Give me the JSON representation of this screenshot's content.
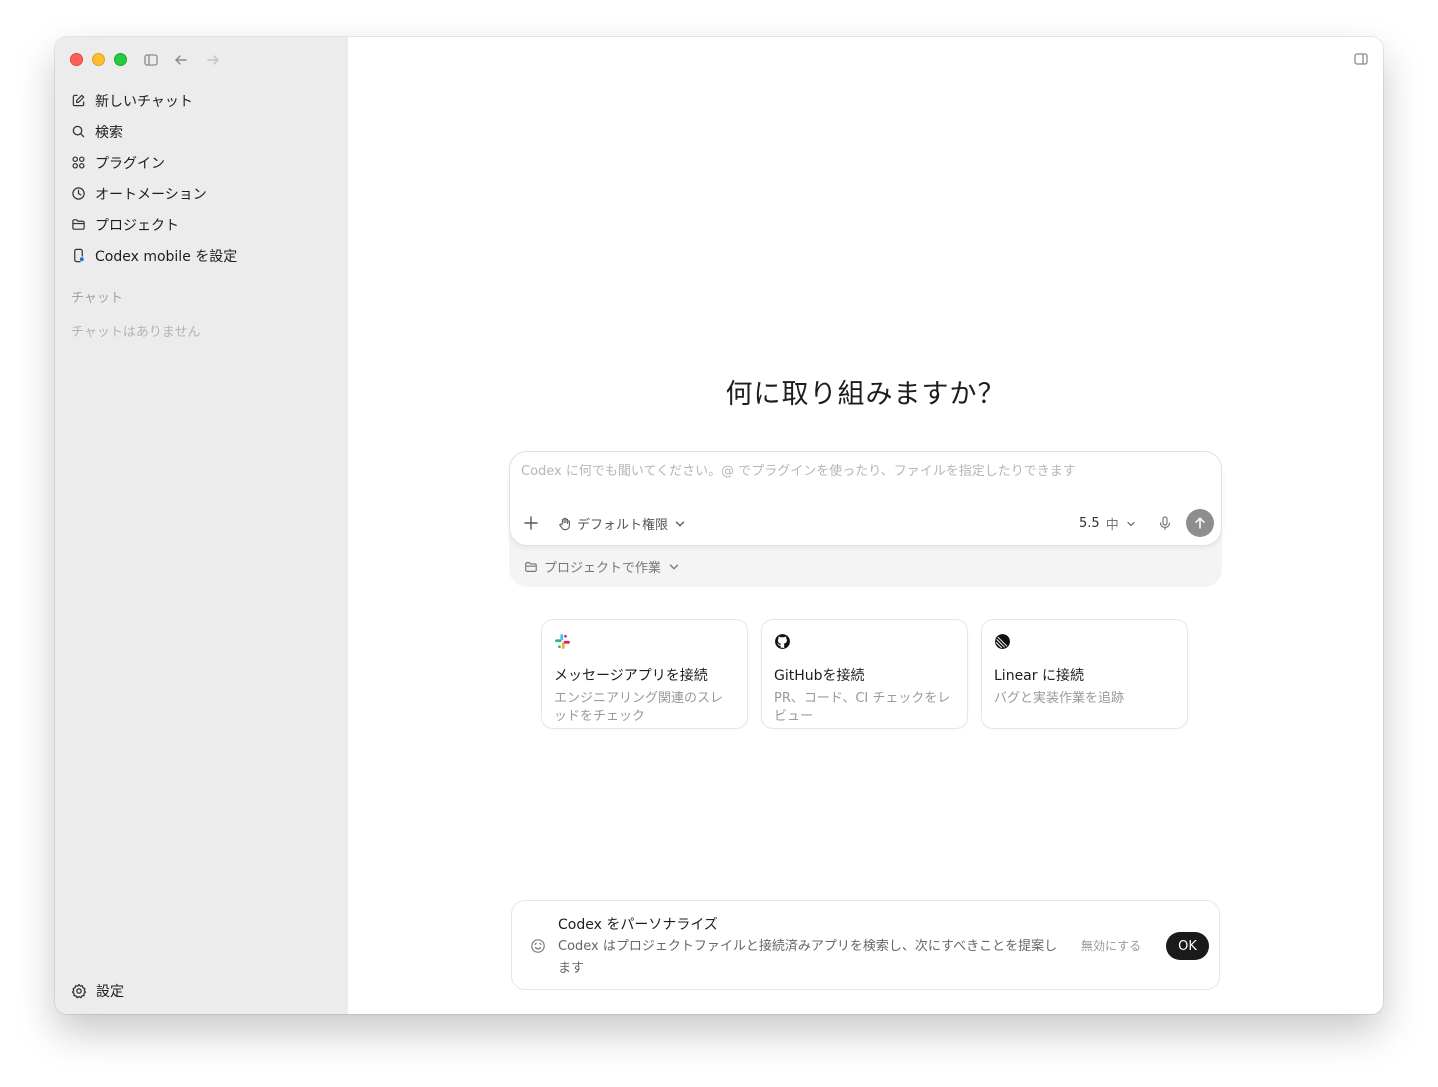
{
  "sidebar": {
    "items": [
      {
        "label": "新しいチャット",
        "icon": "compose-icon"
      },
      {
        "label": "検索",
        "icon": "search-icon"
      },
      {
        "label": "プラグイン",
        "icon": "plugins-icon"
      },
      {
        "label": "オートメーション",
        "icon": "clock-icon"
      },
      {
        "label": "プロジェクト",
        "icon": "folder-icon"
      },
      {
        "label": "Codex mobile を設定",
        "icon": "mobile-icon"
      }
    ],
    "section_label": "チャット",
    "empty_label": "チャットはありません",
    "settings_label": "設定"
  },
  "main": {
    "headline": "何に取り組みますか？",
    "composer": {
      "placeholder": "Codex に何でも聞いてください。@ でプラグインを使ったり、ファイルを指定したりできます",
      "permission_label": "デフォルト権限",
      "model_label": "5.5",
      "effort_label": "中",
      "project_label": "プロジェクトで作業"
    },
    "cards": [
      {
        "title": "メッセージアプリを接続",
        "desc": "エンジニアリング関連のスレッドをチェック",
        "icon": "slack-icon"
      },
      {
        "title": "GitHubを接続",
        "desc": "PR、コード、CI チェックをレビュー",
        "icon": "github-icon"
      },
      {
        "title": "Linear に接続",
        "desc": "バグと実装作業を追跡",
        "icon": "linear-icon"
      }
    ],
    "banner": {
      "title": "Codex をパーソナライズ",
      "text": "Codex はプロジェクトファイルと接続済みアプリを検索し、次にすべきことを提案します",
      "disable_label": "無効にする",
      "ok_label": "OK"
    }
  },
  "colors": {
    "sidebar_bg": "#ececec",
    "send_button": "#8e8e8e",
    "ok_button": "#1a1a1a"
  }
}
